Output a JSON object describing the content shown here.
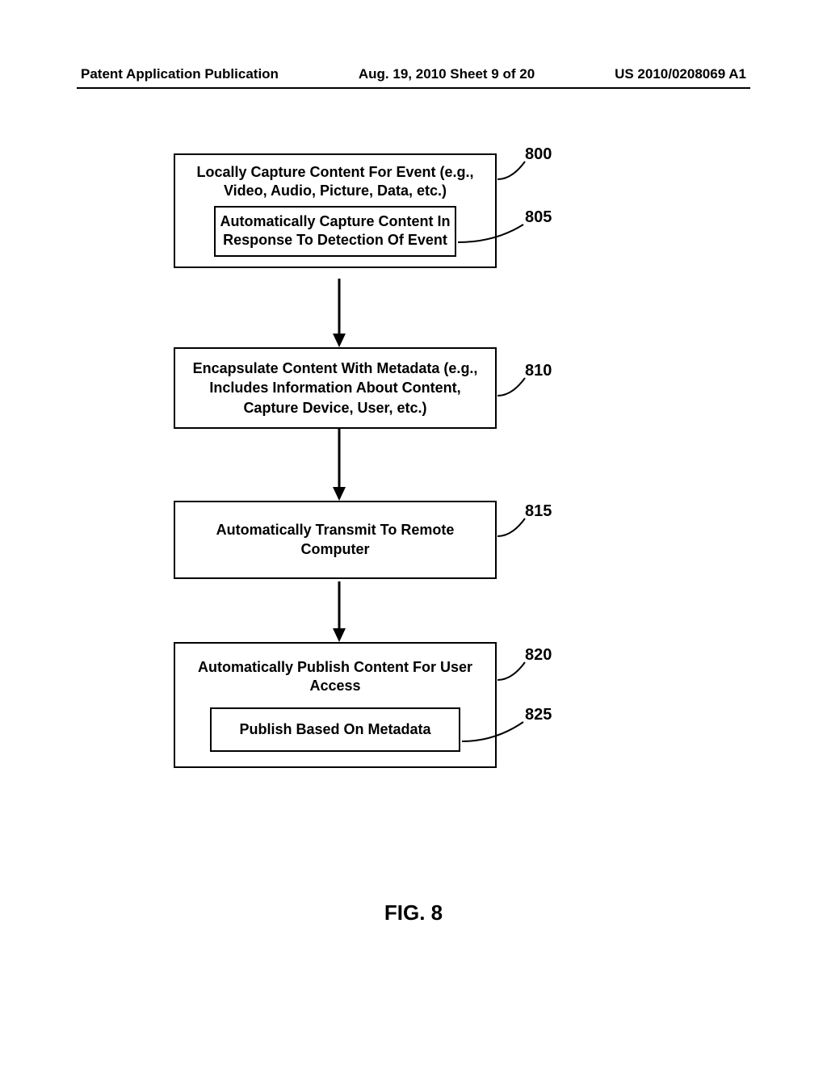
{
  "header": {
    "left": "Patent Application Publication",
    "center": "Aug. 19, 2010  Sheet 9 of 20",
    "right": "US 2010/0208069 A1"
  },
  "chart_data": {
    "type": "flowchart",
    "nodes": [
      {
        "id": "800",
        "text": "Locally Capture Content For Event (e.g., Video, Audio, Picture, Data, etc.)",
        "children": [
          "805"
        ]
      },
      {
        "id": "805",
        "text": "Automatically Capture Content In Response To Detection Of Event",
        "parent": "800"
      },
      {
        "id": "810",
        "text": "Encapsulate Content With Metadata (e.g., Includes Information About Content, Capture Device, User, etc.)"
      },
      {
        "id": "815",
        "text": "Automatically Transmit To Remote Computer"
      },
      {
        "id": "820",
        "text": "Automatically Publish Content For User Access",
        "children": [
          "825"
        ]
      },
      {
        "id": "825",
        "text": "Publish Based On Metadata",
        "parent": "820"
      }
    ],
    "edges": [
      {
        "from": "800",
        "to": "810"
      },
      {
        "from": "810",
        "to": "815"
      },
      {
        "from": "815",
        "to": "820"
      }
    ],
    "figure_label": "FIG. 8"
  }
}
